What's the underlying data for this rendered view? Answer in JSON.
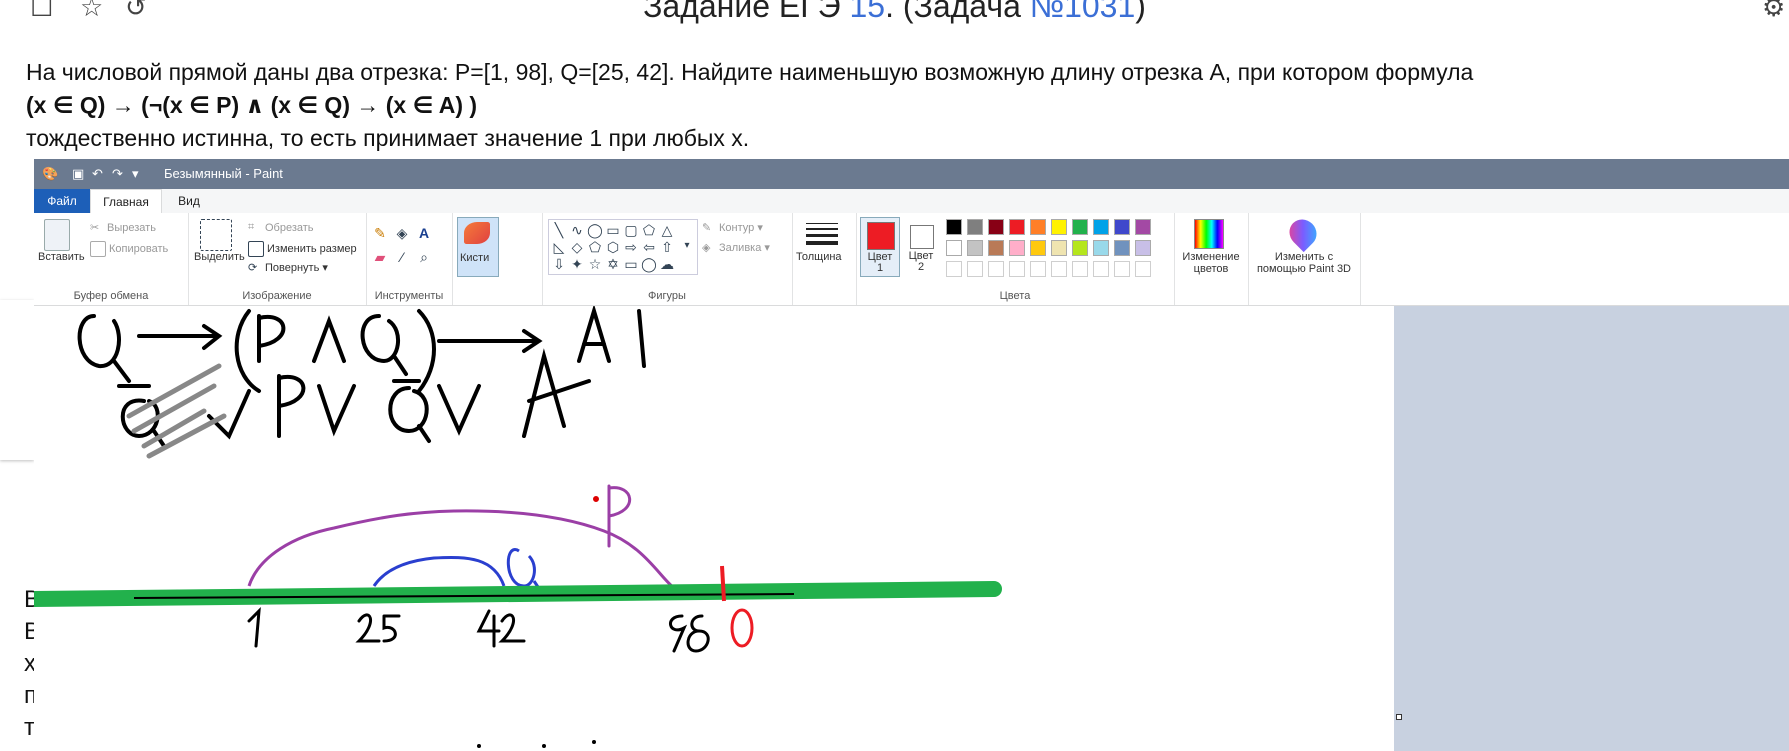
{
  "web": {
    "title_prefix": "Задание ЕГЭ ",
    "title_num": "15",
    "title_mid": ". (Задача ",
    "title_task": "№1031",
    "title_suffix": ")",
    "problem_line1": "На числовой прямой даны два отрезка: P=[1, 98], Q=[25, 42]. Найдите наименьшую возможную длину отрезка A, при котором формула",
    "problem_formula": "(x ∈ Q) → (¬(x ∈ P) ∧ (x ∈ Q) → (x ∈ A) )",
    "problem_line3": "тождественно истинна, то есть принимает значение 1 при любых x.",
    "left_letters": [
      "В",
      "В",
      "х",
      "п",
      "т"
    ]
  },
  "paint": {
    "window_title": "Безымянный - Paint",
    "tabs": {
      "file": "Файл",
      "home": "Главная",
      "view": "Вид"
    },
    "clipboard": {
      "paste": "Вставить",
      "cut": "Вырезать",
      "copy": "Копировать",
      "label": "Буфер обмена"
    },
    "image": {
      "select": "Выделить",
      "crop": "Обрезать",
      "resize": "Изменить размер",
      "rotate": "Повернуть",
      "label": "Изображение"
    },
    "tools": {
      "label": "Инструменты"
    },
    "brushes": {
      "label": "Кисти"
    },
    "shapes": {
      "outline": "Контур",
      "fill": "Заливка",
      "label": "Фигуры"
    },
    "size": {
      "label": "Толщина"
    },
    "colors": {
      "color1": "Цвет 1",
      "color2": "Цвет 2",
      "edit": "Изменение цветов",
      "paint3d": "Изменить с помощью Paint 3D",
      "label": "Цвета",
      "color1_value": "#ed1c24",
      "color2_value": "#ffffff",
      "palette_row1": [
        "#000000",
        "#7f7f7f",
        "#880015",
        "#ed1c24",
        "#ff7f27",
        "#fff200",
        "#22b14c",
        "#00a2e8",
        "#3f48cc",
        "#a349a4"
      ],
      "palette_row2": [
        "#ffffff",
        "#c3c3c3",
        "#b97a57",
        "#ffaec9",
        "#ffc90e",
        "#efe4b0",
        "#b5e61d",
        "#99d9ea",
        "#7092be",
        "#c8bfe7"
      ]
    },
    "canvas_text": {
      "line1": "Q → (P ∧ Q) → A",
      "line2": "Q ∨ P ∨ Q ∨ A",
      "label_p": "P",
      "label_q": "Q",
      "tick_1": "1",
      "tick_25": "25",
      "tick_42": "42",
      "tick_98": "98",
      "tick_0": "0"
    }
  }
}
